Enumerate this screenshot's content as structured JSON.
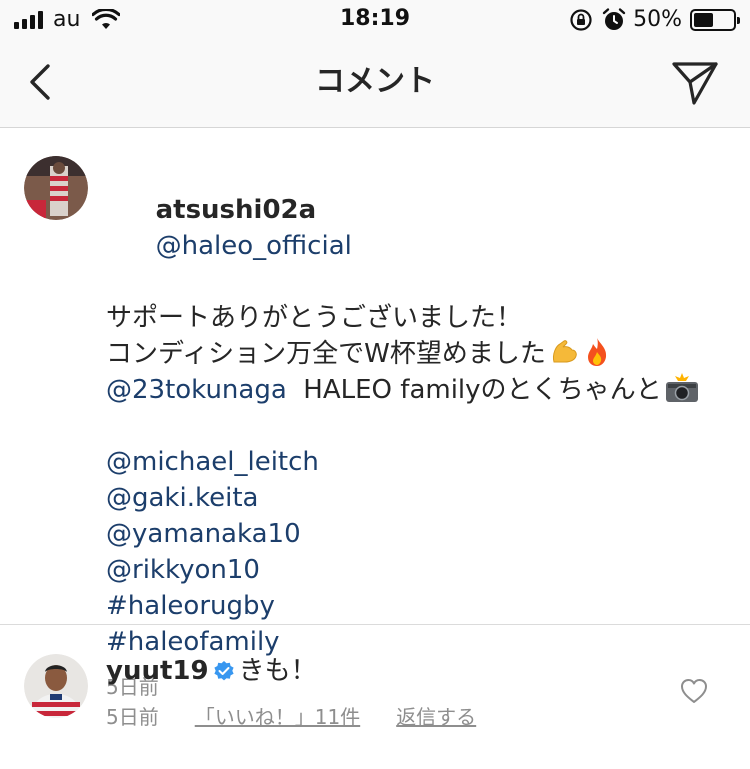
{
  "status_bar": {
    "carrier": "au",
    "time": "18:19",
    "battery_text": "50%",
    "battery_level": 0.5
  },
  "nav": {
    "title": "コメント",
    "back_icon": "chevron-left-icon",
    "send_icon": "paper-plane-icon"
  },
  "caption": {
    "username": "atsushi02a",
    "mention_official": "@haleo_official",
    "line1": "サポートありがとうございました！",
    "line2": "コンディション万全でW杯望めました",
    "line3_mention": "@23tokunaga",
    "line3_text": "  HALEO familyのとくちゃんと",
    "tags": [
      "@michael_leitch",
      "@gaki.keita",
      "@yamanaka10",
      "@rikkyon10",
      "#haleorugby",
      "#haleofamily"
    ],
    "time_ago": "5日前",
    "emojis": [
      "flexed-biceps-icon",
      "fire-icon",
      "camera-flash-icon"
    ]
  },
  "comment": {
    "username": "yuut19",
    "verified": true,
    "text": "きも！",
    "time_ago": "5日前",
    "likes_label": "「いいね！」11件",
    "reply_label": "返信する"
  },
  "colors": {
    "link": "#1c3e6b",
    "meta": "#8e8e8e",
    "verified": "#3897f0"
  }
}
